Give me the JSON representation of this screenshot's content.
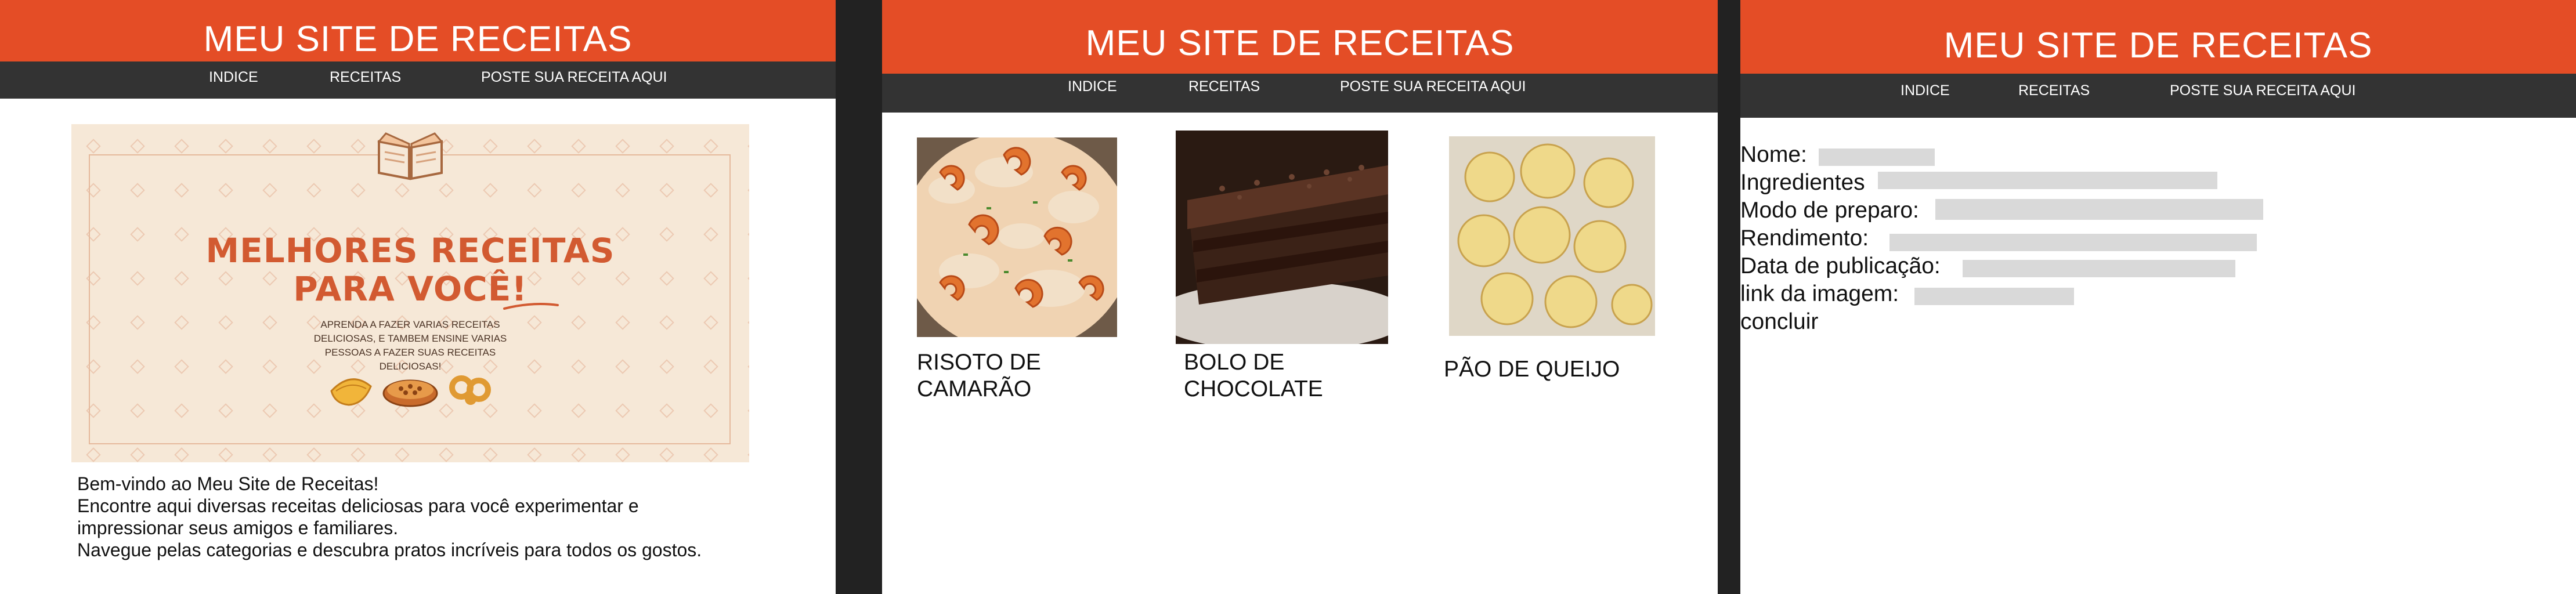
{
  "site_title": "MEU SITE DE RECEITAS",
  "nav": {
    "home": "INDICE",
    "recipes": "RECEITAS",
    "post": "POSTE SUA RECEITA AQUI"
  },
  "colors": {
    "header": "#e44d26",
    "nav": "#333333",
    "divider": "#222222",
    "banner_bg": "#f6e8d7",
    "banner_title": "#d25a31",
    "field": "#d9d9d9"
  },
  "home": {
    "banner": {
      "title_line1": "MELHORES RECEITAS",
      "title_line2": "PARA VOCÊ!",
      "subtitle": "APRENDA A FAZER VARIAS RECEITAS DELICIOSAS, E TAMBEM ENSINE VARIAS PESSOAS A FAZER SUAS RECEITAS DELICIOSAS!",
      "icons": [
        "book-icon",
        "pastry-icon",
        "pie-icon",
        "pretzel-icon"
      ]
    },
    "welcome": [
      "Bem-vindo ao Meu Site de Receitas!",
      "Encontre aqui diversas receitas deliciosas para você experimentar e",
      "impressionar seus amigos e familiares.",
      "Navegue pelas categorias e descubra pratos incríveis para todos os gostos."
    ]
  },
  "recipes": [
    {
      "title_line1": "RISOTO DE",
      "title_line2": "CAMARÃO"
    },
    {
      "title_line1": "BOLO DE",
      "title_line2": "CHOCOLATE"
    },
    {
      "title_line1": "PÃO DE QUEIJO",
      "title_line2": ""
    }
  ],
  "form": {
    "name": "Nome:",
    "ingredients": "Ingredientes",
    "method": "Modo de preparo:",
    "yield": "Rendimento:",
    "date": "Data de publicação:",
    "image_link": "link da imagem:",
    "submit": "concluir"
  }
}
